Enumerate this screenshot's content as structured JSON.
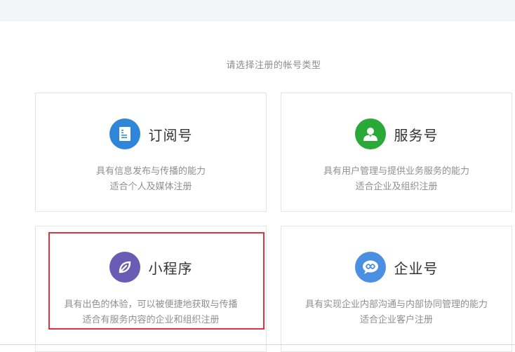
{
  "prompt": "请选择注册的帐号类型",
  "cards": [
    {
      "title": "订阅号",
      "icon": "document-icon",
      "color": "#2f86d9",
      "desc": [
        "具有信息发布与传播的能力",
        "适合个人及媒体注册"
      ]
    },
    {
      "title": "服务号",
      "icon": "person-icon",
      "color": "#2aa838",
      "desc": [
        "具有用户管理与提供业务服务的能力",
        "适合企业及组织注册"
      ]
    },
    {
      "title": "小程序",
      "icon": "leaf-icon",
      "color": "#6a5cb4",
      "desc": [
        "具有出色的体验，可以被便捷地获取与传播",
        "适合有服务内容的企业和组织注册"
      ]
    },
    {
      "title": "企业号",
      "icon": "chat-icon",
      "color": "#4a8fe2",
      "desc": [
        "具有实现企业内部沟通与内部协同管理的能力",
        "适合企业客户注册"
      ]
    }
  ],
  "colors": {
    "highlight": "#d9373c",
    "background": "#ffffff",
    "topbar": "#f4f5f9"
  }
}
